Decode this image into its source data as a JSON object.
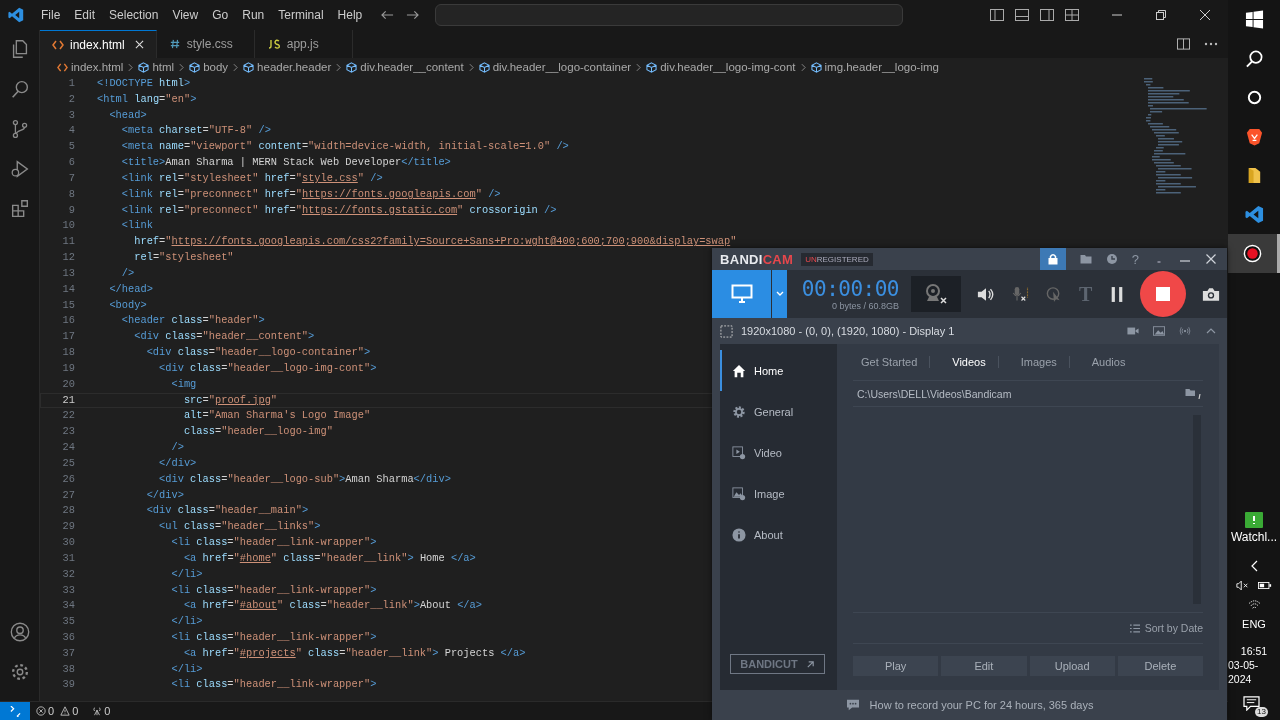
{
  "titlebar": {
    "menus": [
      "File",
      "Edit",
      "Selection",
      "View",
      "Go",
      "Run",
      "Terminal",
      "Help"
    ]
  },
  "tabs": [
    {
      "label": "index.html",
      "kind": "html",
      "selected": true
    },
    {
      "label": "style.css",
      "kind": "css",
      "selected": false
    },
    {
      "label": "app.js",
      "kind": "js",
      "selected": false
    }
  ],
  "breadcrumbs": [
    {
      "label": "index.html",
      "kind": "file"
    },
    {
      "label": "html",
      "kind": "element"
    },
    {
      "label": "body",
      "kind": "element"
    },
    {
      "label": "header.header",
      "kind": "element"
    },
    {
      "label": "div.header__content",
      "kind": "element"
    },
    {
      "label": "div.header__logo-container",
      "kind": "element"
    },
    {
      "label": "div.header__logo-img-cont",
      "kind": "element"
    },
    {
      "label": "img.header__logo-img",
      "kind": "element"
    }
  ],
  "editor": {
    "lines": [
      {
        "number": "1",
        "current": false,
        "tokens": [
          {
            "kind": "tag",
            "text": "<!DOCTYPE"
          },
          {
            "kind": "attr",
            "text": " html"
          },
          {
            "kind": "tag",
            "text": ">"
          }
        ]
      },
      {
        "number": "2",
        "current": false,
        "tokens": [
          {
            "kind": "tag",
            "text": "<html"
          },
          {
            "kind": "attr",
            "text": " lang"
          },
          {
            "kind": "text",
            "text": "="
          },
          {
            "kind": "str",
            "text": "\"en\""
          },
          {
            "kind": "tag",
            "text": ">"
          }
        ]
      },
      {
        "number": "3",
        "current": false,
        "tokens": [
          {
            "kind": "tag",
            "text": "  <head>"
          }
        ]
      },
      {
        "number": "4",
        "current": false,
        "tokens": [
          {
            "kind": "tag",
            "text": "    <meta"
          },
          {
            "kind": "attr",
            "text": " charset"
          },
          {
            "kind": "text",
            "text": "="
          },
          {
            "kind": "str",
            "text": "\"UTF-8\""
          },
          {
            "kind": "tag",
            "text": " />"
          }
        ]
      },
      {
        "number": "5",
        "current": false,
        "tokens": [
          {
            "kind": "tag",
            "text": "    <meta"
          },
          {
            "kind": "attr",
            "text": " name"
          },
          {
            "kind": "text",
            "text": "="
          },
          {
            "kind": "str",
            "text": "\"viewport\""
          },
          {
            "kind": "attr",
            "text": " content"
          },
          {
            "kind": "text",
            "text": "="
          },
          {
            "kind": "str",
            "text": "\"width=device-width, initial-scale=1.0\""
          },
          {
            "kind": "tag",
            "text": " />"
          }
        ]
      },
      {
        "number": "6",
        "current": false,
        "tokens": [
          {
            "kind": "tag",
            "text": "    <title>"
          },
          {
            "kind": "text",
            "text": "Aman Sharma | MERN Stack Web Developer"
          },
          {
            "kind": "tag",
            "text": "</title>"
          }
        ]
      },
      {
        "number": "7",
        "current": false,
        "tokens": [
          {
            "kind": "tag",
            "text": "    <link"
          },
          {
            "kind": "attr",
            "text": " rel"
          },
          {
            "kind": "text",
            "text": "="
          },
          {
            "kind": "str",
            "text": "\"stylesheet\""
          },
          {
            "kind": "attr",
            "text": " href"
          },
          {
            "kind": "text",
            "text": "="
          },
          {
            "kind": "str",
            "text": "\""
          },
          {
            "kind": "link",
            "text": "style.css"
          },
          {
            "kind": "str",
            "text": "\""
          },
          {
            "kind": "tag",
            "text": " />"
          }
        ]
      },
      {
        "number": "8",
        "current": false,
        "tokens": [
          {
            "kind": "tag",
            "text": "    <link"
          },
          {
            "kind": "attr",
            "text": " rel"
          },
          {
            "kind": "text",
            "text": "="
          },
          {
            "kind": "str",
            "text": "\"preconnect\""
          },
          {
            "kind": "attr",
            "text": " href"
          },
          {
            "kind": "text",
            "text": "="
          },
          {
            "kind": "str",
            "text": "\""
          },
          {
            "kind": "link",
            "text": "https://fonts.googleapis.com"
          },
          {
            "kind": "str",
            "text": "\""
          },
          {
            "kind": "tag",
            "text": " />"
          }
        ]
      },
      {
        "number": "9",
        "current": false,
        "tokens": [
          {
            "kind": "tag",
            "text": "    <link"
          },
          {
            "kind": "attr",
            "text": " rel"
          },
          {
            "kind": "text",
            "text": "="
          },
          {
            "kind": "str",
            "text": "\"preconnect\""
          },
          {
            "kind": "attr",
            "text": " href"
          },
          {
            "kind": "text",
            "text": "="
          },
          {
            "kind": "str",
            "text": "\""
          },
          {
            "kind": "link",
            "text": "https://fonts.gstatic.com"
          },
          {
            "kind": "str",
            "text": "\""
          },
          {
            "kind": "attr",
            "text": " crossorigin"
          },
          {
            "kind": "tag",
            "text": " />"
          }
        ]
      },
      {
        "number": "10",
        "current": false,
        "tokens": [
          {
            "kind": "tag",
            "text": "    <link"
          }
        ]
      },
      {
        "number": "11",
        "current": false,
        "tokens": [
          {
            "kind": "attr",
            "text": "      href"
          },
          {
            "kind": "text",
            "text": "="
          },
          {
            "kind": "str",
            "text": "\""
          },
          {
            "kind": "link",
            "text": "https://fonts.googleapis.com/css2?family=Source+Sans+Pro:wght@400;600;700;900&display=swap"
          },
          {
            "kind": "str",
            "text": "\""
          }
        ]
      },
      {
        "number": "12",
        "current": false,
        "tokens": [
          {
            "kind": "attr",
            "text": "      rel"
          },
          {
            "kind": "text",
            "text": "="
          },
          {
            "kind": "str",
            "text": "\"stylesheet\""
          }
        ]
      },
      {
        "number": "13",
        "current": false,
        "tokens": [
          {
            "kind": "tag",
            "text": "    />"
          }
        ]
      },
      {
        "number": "14",
        "current": false,
        "tokens": [
          {
            "kind": "tag",
            "text": "  </head>"
          }
        ]
      },
      {
        "number": "15",
        "current": false,
        "tokens": [
          {
            "kind": "tag",
            "text": "  <body>"
          }
        ]
      },
      {
        "number": "16",
        "current": false,
        "tokens": [
          {
            "kind": "tag",
            "text": "    <header"
          },
          {
            "kind": "attr",
            "text": " class"
          },
          {
            "kind": "text",
            "text": "="
          },
          {
            "kind": "str",
            "text": "\"header\""
          },
          {
            "kind": "tag",
            "text": ">"
          }
        ]
      },
      {
        "number": "17",
        "current": false,
        "tokens": [
          {
            "kind": "tag",
            "text": "      <div"
          },
          {
            "kind": "attr",
            "text": " class"
          },
          {
            "kind": "text",
            "text": "="
          },
          {
            "kind": "str",
            "text": "\"header__content\""
          },
          {
            "kind": "tag",
            "text": ">"
          }
        ]
      },
      {
        "number": "18",
        "current": false,
        "tokens": [
          {
            "kind": "tag",
            "text": "        <div"
          },
          {
            "kind": "attr",
            "text": " class"
          },
          {
            "kind": "text",
            "text": "="
          },
          {
            "kind": "str",
            "text": "\"header__logo-container\""
          },
          {
            "kind": "tag",
            "text": ">"
          }
        ]
      },
      {
        "number": "19",
        "current": false,
        "tokens": [
          {
            "kind": "tag",
            "text": "          <div"
          },
          {
            "kind": "attr",
            "text": " class"
          },
          {
            "kind": "text",
            "text": "="
          },
          {
            "kind": "str",
            "text": "\"header__logo-img-cont\""
          },
          {
            "kind": "tag",
            "text": ">"
          }
        ]
      },
      {
        "number": "20",
        "current": false,
        "tokens": [
          {
            "kind": "tag",
            "text": "            <img"
          }
        ]
      },
      {
        "number": "21",
        "current": true,
        "tokens": [
          {
            "kind": "attr",
            "text": "              src"
          },
          {
            "kind": "text",
            "text": "="
          },
          {
            "kind": "str",
            "text": "\""
          },
          {
            "kind": "link",
            "text": "proof.jpg"
          },
          {
            "kind": "str",
            "text": "\""
          }
        ]
      },
      {
        "number": "22",
        "current": false,
        "tokens": [
          {
            "kind": "attr",
            "text": "              alt"
          },
          {
            "kind": "text",
            "text": "="
          },
          {
            "kind": "str",
            "text": "\"Aman Sharma's Logo Image\""
          }
        ]
      },
      {
        "number": "23",
        "current": false,
        "tokens": [
          {
            "kind": "attr",
            "text": "              class"
          },
          {
            "kind": "text",
            "text": "="
          },
          {
            "kind": "str",
            "text": "\"header__logo-img\""
          }
        ]
      },
      {
        "number": "24",
        "current": false,
        "tokens": [
          {
            "kind": "tag",
            "text": "            />"
          }
        ]
      },
      {
        "number": "25",
        "current": false,
        "tokens": [
          {
            "kind": "tag",
            "text": "          </div>"
          }
        ]
      },
      {
        "number": "26",
        "current": false,
        "tokens": [
          {
            "kind": "tag",
            "text": "          <div"
          },
          {
            "kind": "attr",
            "text": " class"
          },
          {
            "kind": "text",
            "text": "="
          },
          {
            "kind": "str",
            "text": "\"header__logo-sub\""
          },
          {
            "kind": "tag",
            "text": ">"
          },
          {
            "kind": "text",
            "text": "Aman Sharma"
          },
          {
            "kind": "tag",
            "text": "</div>"
          }
        ]
      },
      {
        "number": "27",
        "current": false,
        "tokens": [
          {
            "kind": "tag",
            "text": "        </div>"
          }
        ]
      },
      {
        "number": "28",
        "current": false,
        "tokens": [
          {
            "kind": "tag",
            "text": "        <div"
          },
          {
            "kind": "attr",
            "text": " class"
          },
          {
            "kind": "text",
            "text": "="
          },
          {
            "kind": "str",
            "text": "\"header__main\""
          },
          {
            "kind": "tag",
            "text": ">"
          }
        ]
      },
      {
        "number": "29",
        "current": false,
        "tokens": [
          {
            "kind": "tag",
            "text": "          <ul"
          },
          {
            "kind": "attr",
            "text": " class"
          },
          {
            "kind": "text",
            "text": "="
          },
          {
            "kind": "str",
            "text": "\"header__links\""
          },
          {
            "kind": "tag",
            "text": ">"
          }
        ]
      },
      {
        "number": "30",
        "current": false,
        "tokens": [
          {
            "kind": "tag",
            "text": "            <li"
          },
          {
            "kind": "attr",
            "text": " class"
          },
          {
            "kind": "text",
            "text": "="
          },
          {
            "kind": "str",
            "text": "\"header__link-wrapper\""
          },
          {
            "kind": "tag",
            "text": ">"
          }
        ]
      },
      {
        "number": "31",
        "current": false,
        "tokens": [
          {
            "kind": "tag",
            "text": "              <a"
          },
          {
            "kind": "attr",
            "text": " href"
          },
          {
            "kind": "text",
            "text": "="
          },
          {
            "kind": "str",
            "text": "\""
          },
          {
            "kind": "link",
            "text": "#home"
          },
          {
            "kind": "str",
            "text": "\""
          },
          {
            "kind": "attr",
            "text": " class"
          },
          {
            "kind": "text",
            "text": "="
          },
          {
            "kind": "str",
            "text": "\"header__link\""
          },
          {
            "kind": "tag",
            "text": ">"
          },
          {
            "kind": "text",
            "text": " Home "
          },
          {
            "kind": "tag",
            "text": "</a>"
          }
        ]
      },
      {
        "number": "32",
        "current": false,
        "tokens": [
          {
            "kind": "tag",
            "text": "            </li>"
          }
        ]
      },
      {
        "number": "33",
        "current": false,
        "tokens": [
          {
            "kind": "tag",
            "text": "            <li"
          },
          {
            "kind": "attr",
            "text": " class"
          },
          {
            "kind": "text",
            "text": "="
          },
          {
            "kind": "str",
            "text": "\"header__link-wrapper\""
          },
          {
            "kind": "tag",
            "text": ">"
          }
        ]
      },
      {
        "number": "34",
        "current": false,
        "tokens": [
          {
            "kind": "tag",
            "text": "              <a"
          },
          {
            "kind": "attr",
            "text": " href"
          },
          {
            "kind": "text",
            "text": "="
          },
          {
            "kind": "str",
            "text": "\""
          },
          {
            "kind": "link",
            "text": "#about"
          },
          {
            "kind": "str",
            "text": "\""
          },
          {
            "kind": "attr",
            "text": " class"
          },
          {
            "kind": "text",
            "text": "="
          },
          {
            "kind": "str",
            "text": "\"header__link\""
          },
          {
            "kind": "tag",
            "text": ">"
          },
          {
            "kind": "text",
            "text": "About "
          },
          {
            "kind": "tag",
            "text": "</a>"
          }
        ]
      },
      {
        "number": "35",
        "current": false,
        "tokens": [
          {
            "kind": "tag",
            "text": "            </li>"
          }
        ]
      },
      {
        "number": "36",
        "current": false,
        "tokens": [
          {
            "kind": "tag",
            "text": "            <li"
          },
          {
            "kind": "attr",
            "text": " class"
          },
          {
            "kind": "text",
            "text": "="
          },
          {
            "kind": "str",
            "text": "\"header__link-wrapper\""
          },
          {
            "kind": "tag",
            "text": ">"
          }
        ]
      },
      {
        "number": "37",
        "current": false,
        "tokens": [
          {
            "kind": "tag",
            "text": "              <a"
          },
          {
            "kind": "attr",
            "text": " href"
          },
          {
            "kind": "text",
            "text": "="
          },
          {
            "kind": "str",
            "text": "\""
          },
          {
            "kind": "link",
            "text": "#projects"
          },
          {
            "kind": "str",
            "text": "\""
          },
          {
            "kind": "attr",
            "text": " class"
          },
          {
            "kind": "text",
            "text": "="
          },
          {
            "kind": "str",
            "text": "\"header__link\""
          },
          {
            "kind": "tag",
            "text": ">"
          },
          {
            "kind": "text",
            "text": " Projects "
          },
          {
            "kind": "tag",
            "text": "</a>"
          }
        ]
      },
      {
        "number": "38",
        "current": false,
        "tokens": [
          {
            "kind": "tag",
            "text": "            </li>"
          }
        ]
      },
      {
        "number": "39",
        "current": false,
        "tokens": [
          {
            "kind": "tag",
            "text": "            <li"
          },
          {
            "kind": "attr",
            "text": " class"
          },
          {
            "kind": "text",
            "text": "="
          },
          {
            "kind": "str",
            "text": "\"header__link-wrapper\""
          },
          {
            "kind": "tag",
            "text": ">"
          }
        ]
      }
    ]
  },
  "status_bar": {
    "errors": "0",
    "warnings": "0",
    "ports": "0"
  },
  "taskbar": {
    "apps": [
      {
        "kind": "start",
        "selected": false
      },
      {
        "kind": "search",
        "selected": false
      },
      {
        "kind": "cortana",
        "selected": false
      },
      {
        "kind": "browser",
        "selected": false
      },
      {
        "kind": "files",
        "selected": false
      },
      {
        "kind": "code",
        "selected": false
      },
      {
        "kind": "recorder",
        "selected": true
      }
    ],
    "watchlist": "Watchl...",
    "language": "ENG",
    "time": "16:51",
    "date": "03-05-2024",
    "notifications": "13"
  },
  "bandicam": {
    "logo": [
      "BANDI",
      "CAM"
    ],
    "badge": [
      "UN",
      "REGISTERED"
    ],
    "help": "?",
    "timer": "00:00:00",
    "size": "0 bytes / 60.8GB",
    "text_tool": "T",
    "area": "1920x1080 - (0, 0), (1920, 1080) - Display 1",
    "nav": [
      {
        "label": "Home",
        "kind": "home",
        "selected": true
      },
      {
        "label": "General",
        "kind": "general",
        "selected": false
      },
      {
        "label": "Video",
        "kind": "video",
        "selected": false
      },
      {
        "label": "Image",
        "kind": "image",
        "selected": false
      },
      {
        "label": "About",
        "kind": "about",
        "selected": false
      }
    ],
    "bandicut": "BANDICUT",
    "tabs": [
      {
        "label": "Get Started",
        "selected": false
      },
      {
        "label": "Videos",
        "selected": true
      },
      {
        "label": "Images",
        "selected": false
      },
      {
        "label": "Audios",
        "selected": false
      }
    ],
    "path": "C:\\Users\\DELL\\Videos\\Bandicam",
    "sort": "Sort by Date",
    "buttons": [
      "Play",
      "Edit",
      "Upload",
      "Delete"
    ],
    "tip": "How to record your PC for 24 hours, 365 days"
  }
}
